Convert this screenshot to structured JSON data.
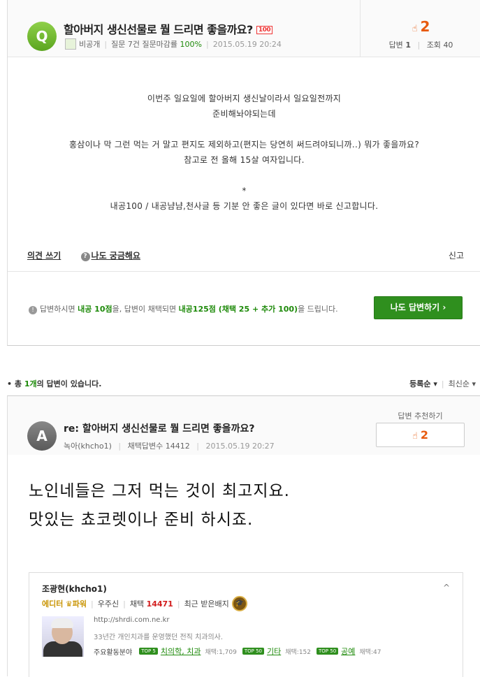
{
  "question": {
    "icon_letter": "Q",
    "title": "할아버지 생신선물로 뭘 드리면 좋을까요?",
    "badge": "100",
    "author": "비공개",
    "stat_label": "질문 7건 질문마감률",
    "rate": "100%",
    "date": "2015.05.19 20:24",
    "likes": "2",
    "answers_label": "답변",
    "answers": "1",
    "views_label": "조회",
    "views": "40",
    "body": [
      "이번주 일요일에 할아버지 생신날이라서 일요일전까지",
      "준비해놔야되는데",
      "",
      "홍삼이나 막 그런 먹는 거 말고 편지도 제외하고(편지는 당연히 써드려야되니까..) 뭐가 좋을까요?",
      "참고로 전 올해 15살 여자입니다.",
      "",
      "*",
      "내공100 / 내공냠냠,천사글 등 기분 안 좋은 글이 있다면 바로 신고합니다."
    ],
    "comment_link": "의견 쓰기",
    "curious_link": "나도 궁금해요",
    "report": "신고",
    "notice": {
      "p1": "답변하시면 ",
      "g1": "내공 10점",
      "p2": "을, 답변이 채택되면 ",
      "g2": "내공125점 (채택 25 + 추가 100)",
      "p3": "을 드립니다."
    },
    "answer_button": "나도 답변하기 ›"
  },
  "answer_count": {
    "prefix": "• 총 ",
    "count": "1개",
    "suffix": "의 답변이 있습니다."
  },
  "sort": {
    "registered": "등록순 ▾",
    "latest": "최신순 ▾"
  },
  "answer": {
    "icon_letter": "A",
    "title": "re: 할아버지 생신선물로 뭘 드리면 좋을까요?",
    "author": "녹아(khcho1)",
    "adopt_label": "채택답변수",
    "adopt_count": "14412",
    "date": "2015.05.19 20:27",
    "recommend_label": "답변 추천하기",
    "likes": "2",
    "body": [
      "노인네들은 그저 먹는 것이 최고지요.",
      "맛있는 쵸코렛이나 준비 하시죠."
    ]
  },
  "profile": {
    "name": "조광현(khcho1)",
    "rank": "에디터",
    "power": "파워",
    "sub": "우주신",
    "adopt_label": "채택",
    "adopt": "14471",
    "badge_label": "최근 받은배지",
    "blog": "http://shrdi.com.ne.kr",
    "desc": "33년간 개인치과를 운영했던 전직 치과의사.",
    "areas_label": "주요활동분야",
    "areas": [
      {
        "tag": "TOP 5",
        "name": "치의학, 치과",
        "count": "채택:1,709"
      },
      {
        "tag": "TOP 50",
        "name": "기타",
        "count": "채택:152"
      },
      {
        "tag": "TOP 50",
        "name": "공예",
        "count": "채택:47"
      }
    ]
  },
  "colors": {
    "accent_green": "#2f8f1e",
    "like_orange": "#e75a0e",
    "red": "#d21d1d"
  }
}
